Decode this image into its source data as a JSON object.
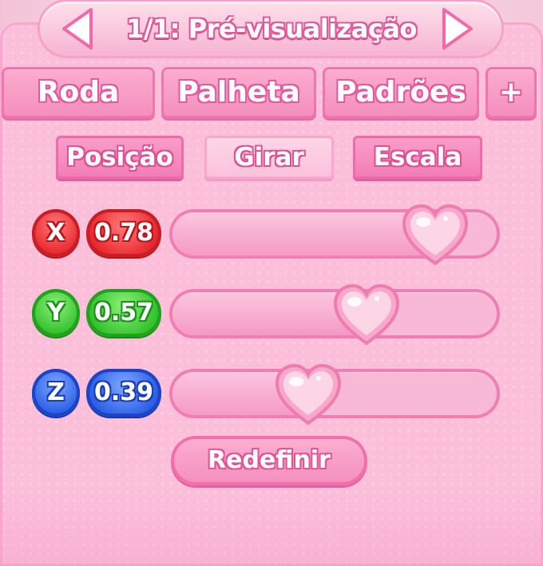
{
  "header": {
    "title": "1/1: Pré-visualização",
    "prev_icon": "arrow-left-icon",
    "next_icon": "arrow-right-icon"
  },
  "tabs": [
    {
      "label": "Roda"
    },
    {
      "label": "Palheta"
    },
    {
      "label": "Padrões"
    },
    {
      "label": "+"
    }
  ],
  "subtabs": [
    {
      "label": "Posição",
      "active": false
    },
    {
      "label": "Girar",
      "active": true
    },
    {
      "label": "Escala",
      "active": false
    }
  ],
  "sliders": [
    {
      "axis": "X",
      "value": "0.78",
      "level": 0.78,
      "color": "#e8282f"
    },
    {
      "axis": "Y",
      "value": "0.57",
      "level": 0.57,
      "color": "#33c12c"
    },
    {
      "axis": "Z",
      "value": "0.39",
      "level": 0.39,
      "color": "#2a5fe6"
    }
  ],
  "reset_label": "Redefinir",
  "colors": {
    "panel": "#fbbfd9",
    "accent": "#f074ad",
    "text": "#ffffff"
  },
  "slider_knob_icon": "heart-icon"
}
